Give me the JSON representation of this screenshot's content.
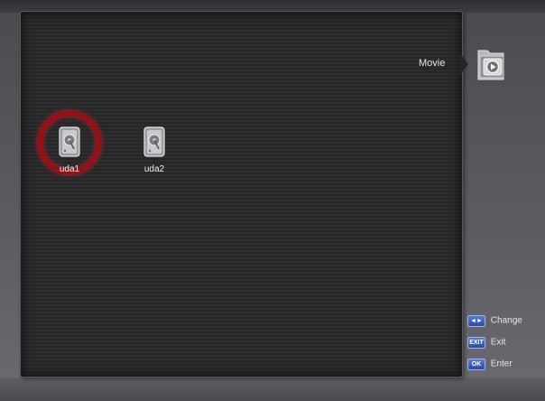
{
  "category": {
    "label": "Movie",
    "icon": "movie-folder-icon"
  },
  "devices": [
    {
      "label": "uda1",
      "icon": "hard-disk-icon",
      "selected": true
    },
    {
      "label": "uda2",
      "icon": "hard-disk-icon",
      "selected": false
    }
  ],
  "legend": [
    {
      "key": "◄►",
      "label": "Change"
    },
    {
      "key": "EXIT",
      "label": "Exit"
    },
    {
      "key": "OK",
      "label": "Enter"
    }
  ],
  "colors": {
    "selection_ring": "#9a0f16",
    "key_blue": "#2c4aa0",
    "panel": "#262628"
  }
}
